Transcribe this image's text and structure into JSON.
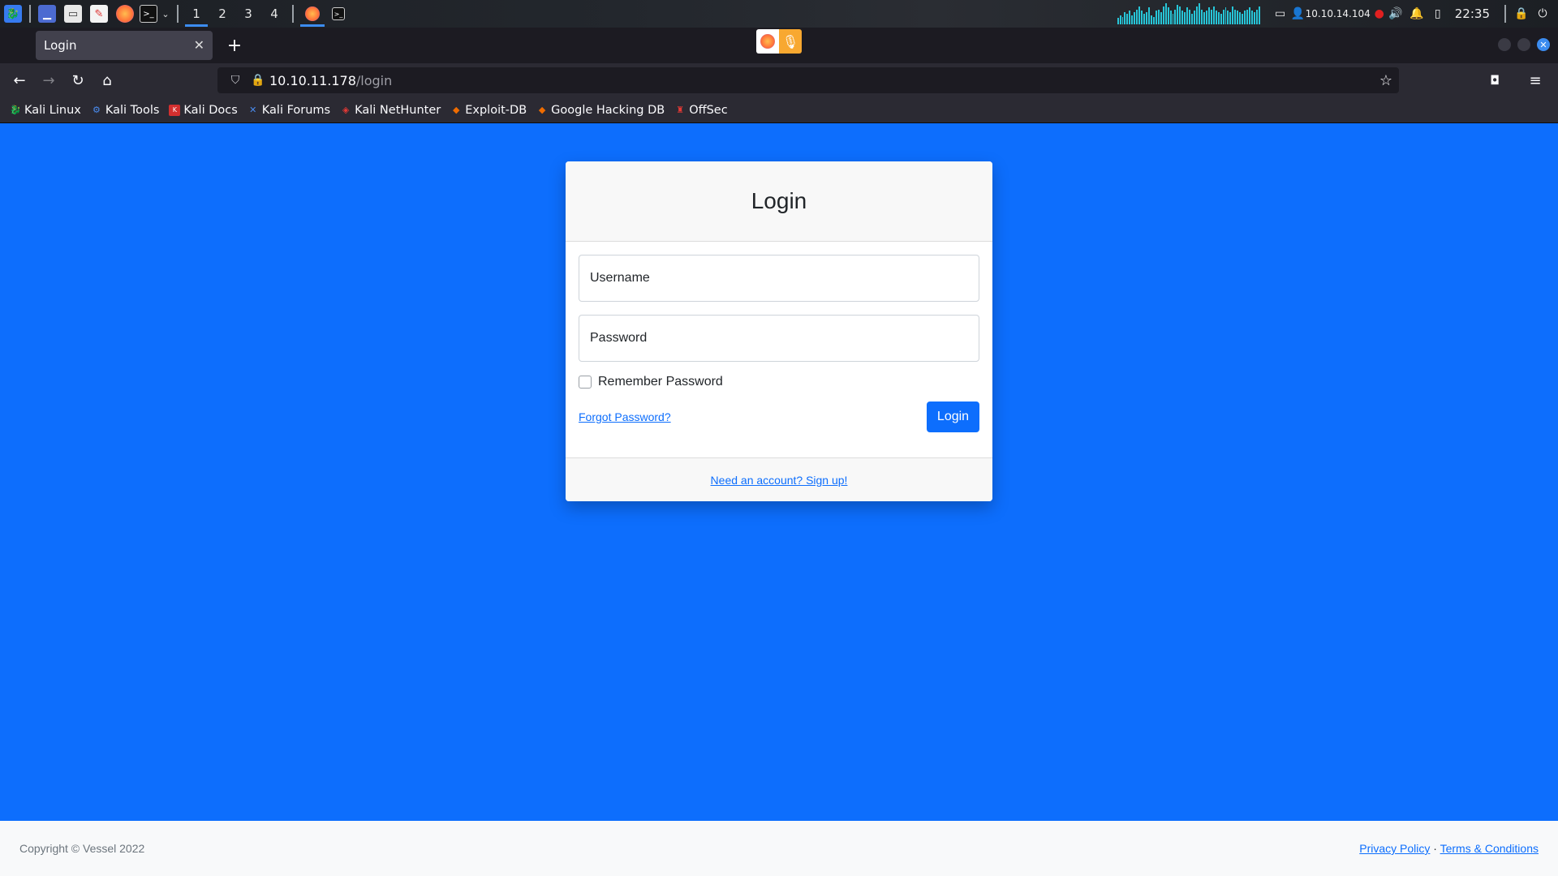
{
  "panel": {
    "workspaces": [
      "1",
      "2",
      "3",
      "4"
    ],
    "active_workspace": "1",
    "ip": "10.10.14.104",
    "clock": "22:35",
    "net_bars": [
      4,
      6,
      5,
      8,
      7,
      9,
      6,
      8,
      10,
      12,
      9,
      7,
      8,
      11,
      6,
      5,
      9,
      10,
      8,
      12,
      14,
      11,
      9,
      7,
      10,
      13,
      12,
      9,
      8,
      11,
      10,
      7,
      9,
      12,
      14,
      10,
      8,
      9,
      11,
      10,
      12,
      9,
      8,
      7,
      10,
      11,
      9,
      8,
      12,
      10,
      9,
      8,
      7,
      9,
      10,
      11,
      9,
      8,
      10,
      12
    ]
  },
  "browser": {
    "tab_title": "Login",
    "url_host": "10.10.11.178",
    "url_path": "/login",
    "bookmarks": [
      "Kali Linux",
      "Kali Tools",
      "Kali Docs",
      "Kali Forums",
      "Kali NetHunter",
      "Exploit-DB",
      "Google Hacking DB",
      "OffSec"
    ]
  },
  "login": {
    "title": "Login",
    "username_placeholder": "Username",
    "password_placeholder": "Password",
    "remember_label": "Remember Password",
    "forgot_label": "Forgot Password?",
    "button_label": "Login",
    "signup_label": "Need an account? Sign up!"
  },
  "footer": {
    "copyright": "Copyright © Vessel 2022",
    "privacy": "Privacy Policy",
    "separator": "·",
    "terms": "Terms & Conditions"
  },
  "colors": {
    "page_bg": "#0d6efd",
    "accent": "#0d6efd"
  }
}
